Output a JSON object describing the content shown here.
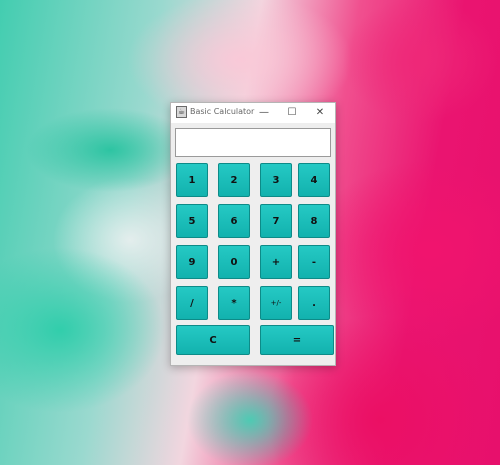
{
  "window": {
    "title": "Basic Calculator",
    "minimize_glyph": "—",
    "maximize_glyph": "☐",
    "close_glyph": "✕",
    "icon": "java-app-icon"
  },
  "display": {
    "value": ""
  },
  "buttons": {
    "b1": "1",
    "b2": "2",
    "b3": "3",
    "b4": "4",
    "b5": "5",
    "b6": "6",
    "b7": "7",
    "b8": "8",
    "b9": "9",
    "b0": "0",
    "plus": "+",
    "minus": "-",
    "divide": "/",
    "multiply": "*",
    "negate": "+/-",
    "decimal": ".",
    "clear": "C",
    "equals": "="
  },
  "colors": {
    "button": "#1dbfbb",
    "window": "#eeeeee"
  }
}
